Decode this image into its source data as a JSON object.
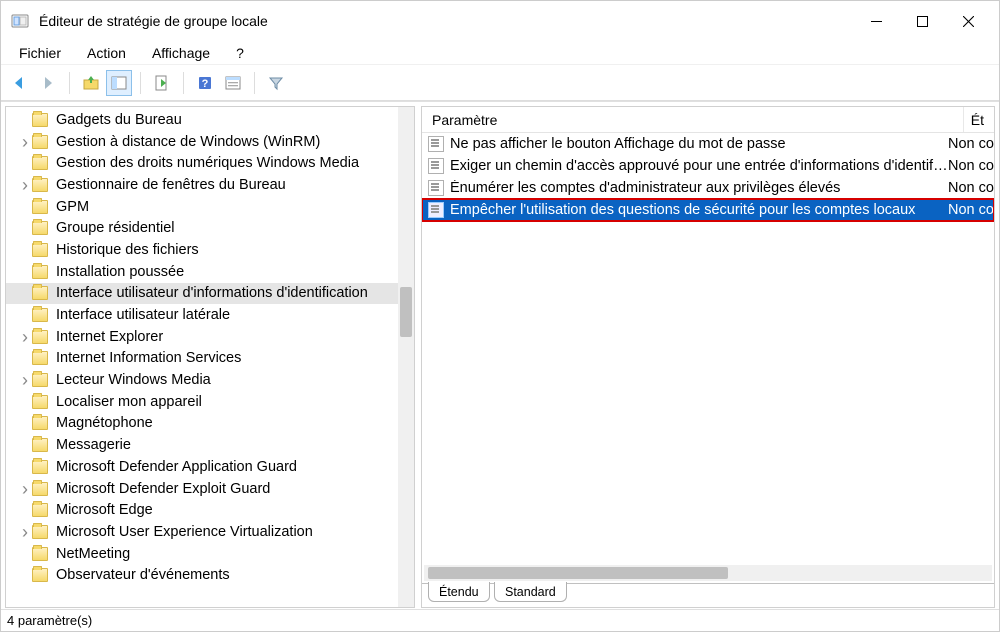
{
  "window": {
    "title": "Éditeur de stratégie de groupe locale"
  },
  "menu": {
    "file": "Fichier",
    "action": "Action",
    "view": "Affichage",
    "help": "?"
  },
  "tree": {
    "items": [
      {
        "label": "Gadgets du Bureau",
        "expandable": false
      },
      {
        "label": "Gestion à distance de Windows (WinRM)",
        "expandable": true
      },
      {
        "label": "Gestion des droits numériques Windows Media",
        "expandable": false
      },
      {
        "label": "Gestionnaire de fenêtres du Bureau",
        "expandable": true
      },
      {
        "label": "GPM",
        "expandable": false
      },
      {
        "label": "Groupe résidentiel",
        "expandable": false
      },
      {
        "label": "Historique des fichiers",
        "expandable": false
      },
      {
        "label": "Installation poussée",
        "expandable": false
      },
      {
        "label": "Interface utilisateur d'informations d'identification",
        "expandable": false,
        "selected": true
      },
      {
        "label": "Interface utilisateur latérale",
        "expandable": false
      },
      {
        "label": "Internet Explorer",
        "expandable": true
      },
      {
        "label": "Internet Information Services",
        "expandable": false
      },
      {
        "label": "Lecteur Windows Media",
        "expandable": true
      },
      {
        "label": "Localiser mon appareil",
        "expandable": false
      },
      {
        "label": "Magnétophone",
        "expandable": false
      },
      {
        "label": "Messagerie",
        "expandable": false
      },
      {
        "label": "Microsoft Defender Application Guard",
        "expandable": false
      },
      {
        "label": "Microsoft Defender Exploit Guard",
        "expandable": true
      },
      {
        "label": "Microsoft Edge",
        "expandable": false
      },
      {
        "label": "Microsoft User Experience Virtualization",
        "expandable": true
      },
      {
        "label": "NetMeeting",
        "expandable": false
      },
      {
        "label": "Observateur d'événements",
        "expandable": false
      }
    ]
  },
  "detail": {
    "header_param": "Paramètre",
    "header_etat": "Ét",
    "items": [
      {
        "label": "Ne pas afficher le bouton Affichage du mot de passe",
        "state": "Non co"
      },
      {
        "label": "Exiger un chemin d'accès approuvé pour une entrée d'informations d'identifi...",
        "state": "Non co"
      },
      {
        "label": "Énumérer les comptes d'administrateur aux privilèges élevés",
        "state": "Non co"
      },
      {
        "label": "Empêcher l'utilisation des questions de sécurité pour les comptes locaux",
        "state": "Non co",
        "selected": true
      }
    ]
  },
  "tabs": {
    "extended": "Étendu",
    "standard": "Standard"
  },
  "statusbar": "4 paramètre(s)"
}
